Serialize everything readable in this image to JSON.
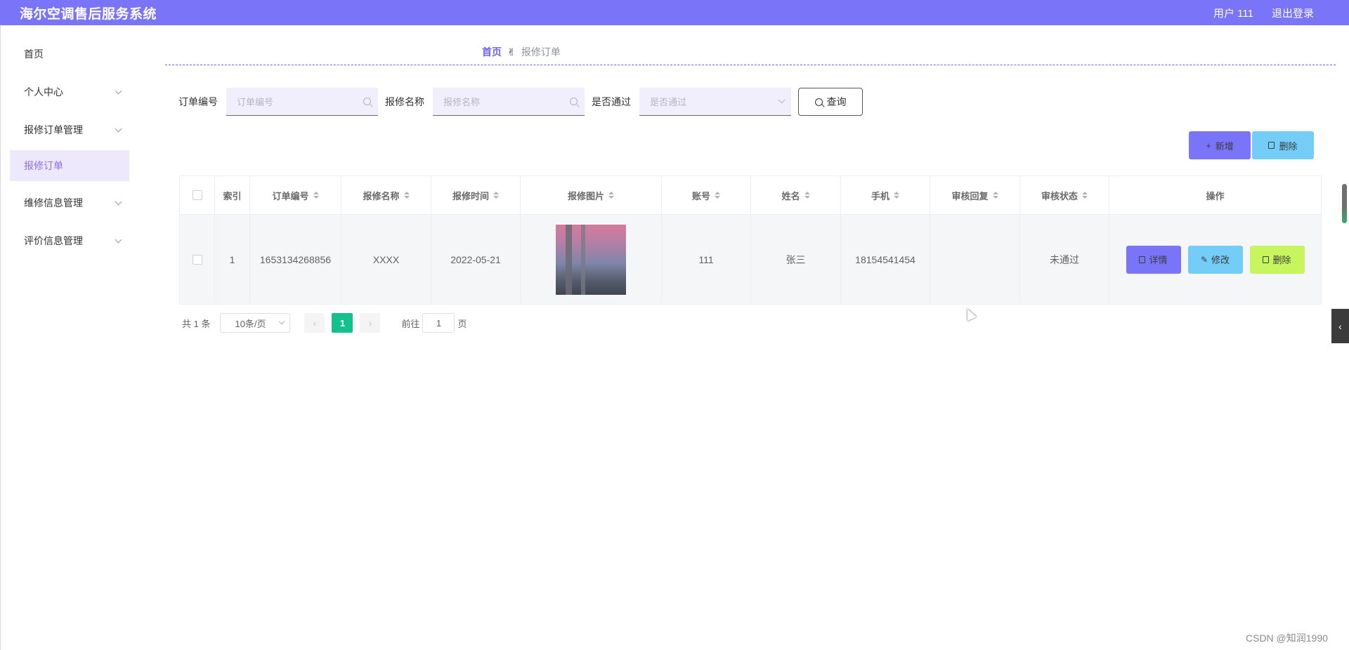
{
  "app": {
    "title": "海尔空调售后服务系统"
  },
  "header": {
    "user": "用户 111",
    "logout": "退出登录"
  },
  "sidebar": {
    "items": [
      {
        "label": "首页",
        "has_children": false
      },
      {
        "label": "个人中心",
        "has_children": true
      },
      {
        "label": "报修订单管理",
        "has_children": true
      },
      {
        "label": "报修订单",
        "active": true
      },
      {
        "label": "维修信息管理",
        "has_children": true
      },
      {
        "label": "评价信息管理",
        "has_children": true
      }
    ]
  },
  "breadcrumb": {
    "home": "首页",
    "separator": "✌",
    "current": "报修订单"
  },
  "filters": {
    "order_no": {
      "label": "订单编号",
      "placeholder": "订单编号"
    },
    "repair_name": {
      "label": "报修名称",
      "placeholder": "报修名称"
    },
    "passed": {
      "label": "是否通过",
      "placeholder": "是否通过"
    },
    "query_button": "查询"
  },
  "toolbar": {
    "add": "新增",
    "delete": "删除",
    "add_symbol": "+"
  },
  "table": {
    "columns": [
      "索引",
      "订单编号",
      "报修名称",
      "报修时间",
      "报修图片",
      "账号",
      "姓名",
      "手机",
      "审核回复",
      "审核状态",
      "操作"
    ],
    "rows": [
      {
        "index": "1",
        "order_no": "1653134268856",
        "repair_name": "XXXX",
        "repair_time": "2022-05-21",
        "account": "111",
        "name": "张三",
        "phone": "18154541454",
        "review_reply": "",
        "review_status": "未通过"
      }
    ],
    "actions": {
      "detail": "详情",
      "edit": "修改",
      "delete": "删除"
    }
  },
  "pagination": {
    "total": "共 1 条",
    "page_size": "10条/页",
    "prev": "‹",
    "current": "1",
    "next": "›",
    "goto_label": "前往",
    "goto_value": "1",
    "page_unit": "页"
  },
  "side_tab": "‹",
  "watermark": "CSDN @知润1990",
  "colors": {
    "topbar": "#7a74f9",
    "accent": "#6f64e8",
    "pager_active": "#13c18c",
    "edit": "#73cdf7",
    "delete": "#c7f55e"
  }
}
